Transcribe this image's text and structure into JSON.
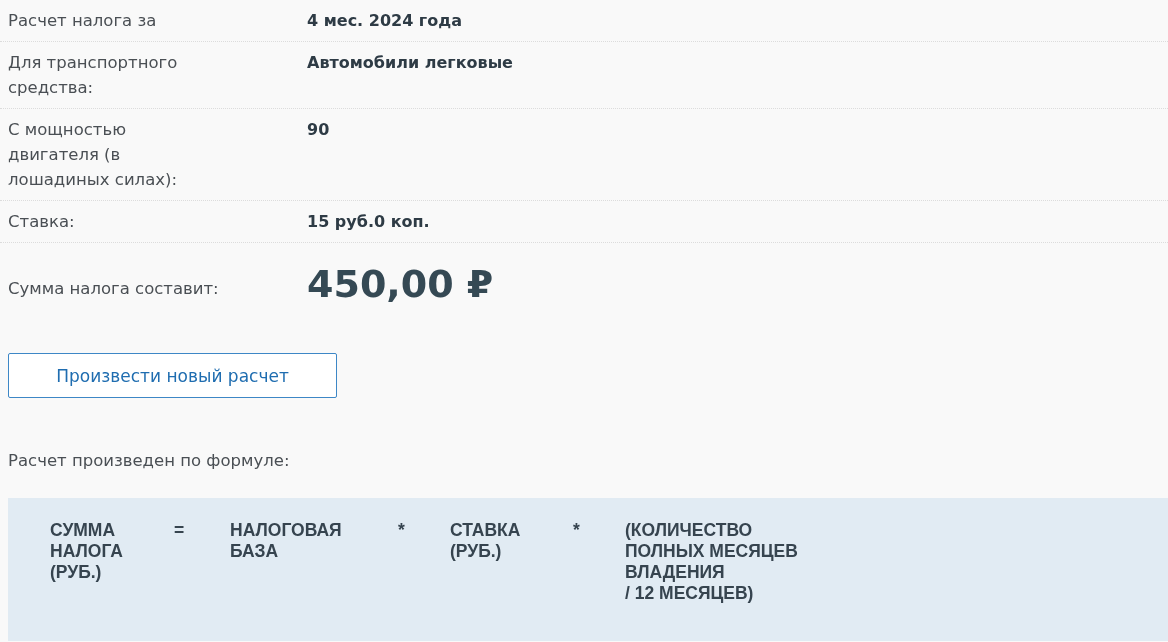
{
  "result_rows": [
    {
      "label": "Расчет налога за",
      "value": "4 мес. 2024 года"
    },
    {
      "label": "Для транспортного средства:",
      "value": "Автомобили легковые"
    },
    {
      "label": "С мощностью двигателя (в лошадиных силах):",
      "value": "90"
    },
    {
      "label": "Ставка:",
      "value": "15 руб.0 коп."
    }
  ],
  "total": {
    "label": "Сумма налога составит:",
    "value": "450,00 ₽"
  },
  "new_calculation_button": "Произвести новый расчет",
  "formula_caption": "Расчет произведен по формуле:",
  "formula": [
    {
      "kind": "term",
      "lines": [
        "СУММА",
        "НАЛОГА",
        "(РУБ.)"
      ]
    },
    {
      "kind": "operator",
      "text": "="
    },
    {
      "kind": "term",
      "lines": [
        "НАЛОГОВАЯ",
        "БАЗА"
      ]
    },
    {
      "kind": "operator",
      "text": "*"
    },
    {
      "kind": "term",
      "lines": [
        "СТАВКА",
        "(РУБ.)"
      ]
    },
    {
      "kind": "operator",
      "text": "*"
    },
    {
      "kind": "term",
      "lines": [
        "(КОЛИЧЕСТВО",
        "ПОЛНЫХ МЕСЯЦЕВ",
        "ВЛАДЕНИЯ",
        "/ 12 МЕСЯЦЕВ)"
      ]
    }
  ]
}
